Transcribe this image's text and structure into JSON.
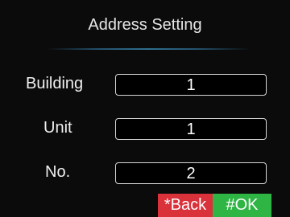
{
  "header": {
    "title": "Address Setting"
  },
  "form": {
    "building": {
      "label": "Building",
      "value": "1"
    },
    "unit": {
      "label": "Unit",
      "value": "1"
    },
    "number": {
      "label": "No.",
      "value": "2"
    }
  },
  "actions": {
    "back_label": "*Back",
    "ok_label": "#OK"
  },
  "colors": {
    "background": "#0b0b0b",
    "back_button": "#d9323b",
    "ok_button": "#2fb544",
    "field_border": "#d6d6d6",
    "divider": "#2f6f8f"
  }
}
